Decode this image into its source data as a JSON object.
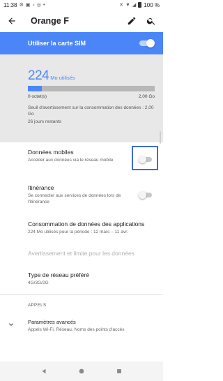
{
  "status_bar": {
    "time": "11:38",
    "battery": "100 %"
  },
  "header": {
    "title": "Orange F",
    "back_icon": "arrow-back-icon",
    "edit_icon": "pencil-icon",
    "search_icon": "search-icon"
  },
  "sim": {
    "label": "Utiliser la carte SIM",
    "enabled": true
  },
  "usage": {
    "amount": "224",
    "unit": "Mo utilisés",
    "fill_fraction": 0.11,
    "min": "0 octet(s)",
    "max": "2,00 Go",
    "warning": "Seuil d'avertissement sur la consommation des données : 2,00 Go",
    "days_left": "26 jours restants"
  },
  "settings": [
    {
      "title": "Données mobiles",
      "subtitle": "Accéder aux données via le réseau mobile",
      "toggle": false
    },
    {
      "title": "Itinérance",
      "subtitle": "Se connecter aux services de données lors de l'itinérance",
      "toggle": false
    },
    {
      "title": "Consommation de données des applications",
      "subtitle": "224 Mo utilisés pour la période : 12 mars – 11 avr."
    },
    {
      "title": "Avertissement et limite pour les données",
      "disabled": true
    },
    {
      "title": "Type de réseau préféré",
      "subtitle": "4G/3G/2G"
    }
  ],
  "calls": {
    "header": "APPELS",
    "advanced_title": "Paramètres avancés",
    "advanced_subtitle": "Appels Wi-Fi, Réseau, Noms des points d'accès"
  },
  "colors": {
    "accent": "#4a86f7",
    "highlight": "#3b6fd4"
  }
}
